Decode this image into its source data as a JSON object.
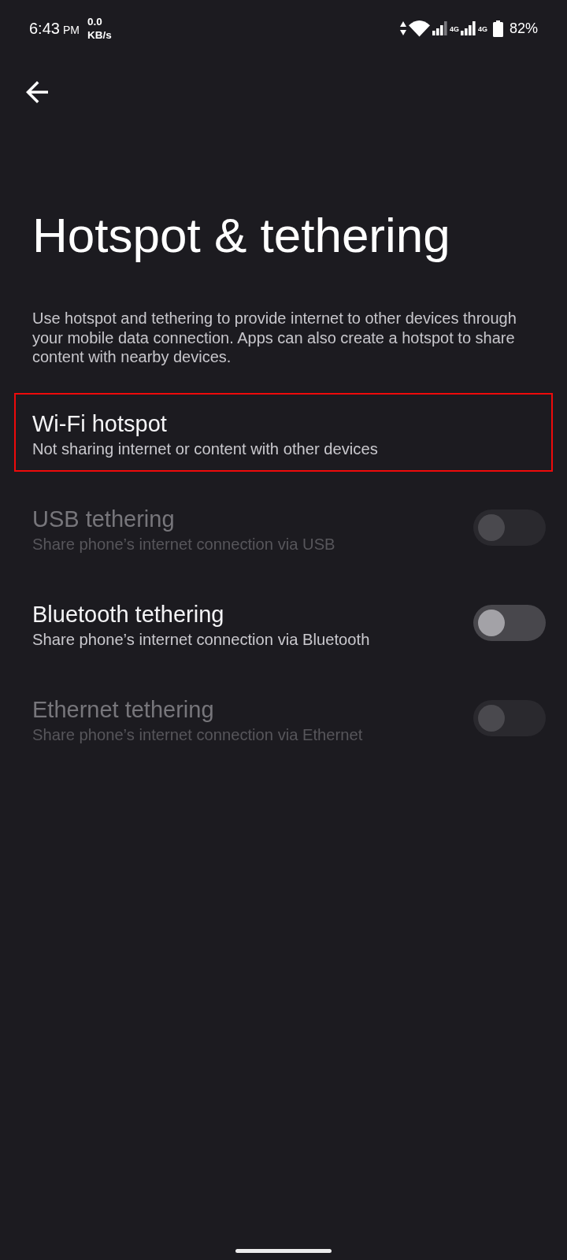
{
  "status_bar": {
    "time": "6:43",
    "period": "PM",
    "data_rate": "0.0",
    "data_rate_unit": "KB/s",
    "network_labels": [
      "4G",
      "4G"
    ],
    "battery": "82%"
  },
  "title": "Hotspot & tethering",
  "description": "Use hotspot and tethering to provide internet to other devices through your mobile data connection. Apps can also create a hotspot to share content with nearby devices.",
  "items": [
    {
      "kind": "link",
      "title": "Wi-Fi hotspot",
      "summary": "Not sharing internet or content with other devices",
      "disabled": false,
      "highlighted": true
    },
    {
      "kind": "switch",
      "title": "USB tethering",
      "summary": "Share phone’s internet connection via USB",
      "disabled": true,
      "on": false,
      "highlighted": false
    },
    {
      "kind": "switch",
      "title": "Bluetooth tethering",
      "summary": "Share phone’s internet connection via Bluetooth",
      "disabled": false,
      "on": false,
      "highlighted": false
    },
    {
      "kind": "switch",
      "title": "Ethernet tethering",
      "summary": "Share phone’s internet connection via Ethernet",
      "disabled": true,
      "on": false,
      "highlighted": false
    }
  ]
}
